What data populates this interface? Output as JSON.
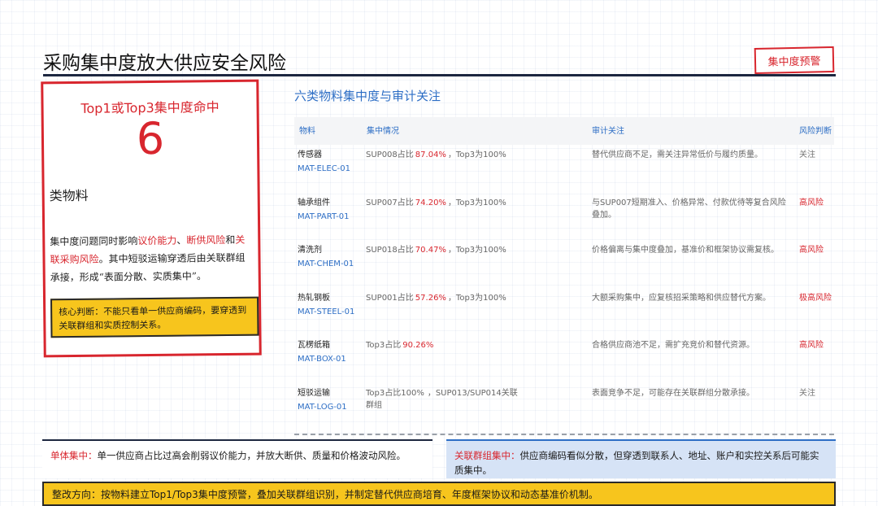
{
  "header": {
    "title": "采购集中度放大供应安全风险",
    "badge": "集中度预警"
  },
  "left_card": {
    "hit_title": "Top1或Top3集中度命中",
    "count": "6",
    "unit": "类物料",
    "desc_1": "集中度问题同时影响",
    "desc_red_1": "议价能力",
    "desc_sep": "、",
    "desc_red_2": "断供风险",
    "desc_and": "和",
    "desc_red_3": "关联采购风险",
    "desc_2": "。其中短驳运输穿透后由关联群组承接，形成“表面分散、实质集中”。",
    "core_judgement": "核心判断：不能只看单一供应商编码，要穿透到关联群组和实质控制关系。"
  },
  "section": {
    "title": "六类物料集中度与审计关注"
  },
  "table": {
    "headers": {
      "material": "物料",
      "concentration": "集中情况",
      "audit": "审计关注",
      "risk": "风险判断"
    },
    "rows": [
      {
        "name": "传感器",
        "code": "MAT-ELEC-01",
        "conc_prefix": "SUP008占比",
        "pct": "87.04%",
        "conc_suffix": "，Top3为100%",
        "audit": "替代供应商不足，需关注异常低价与履约质量。",
        "risk": "关注",
        "risk_color": "#777777"
      },
      {
        "name": "轴承组件",
        "code": "MAT-PART-01",
        "conc_prefix": "SUP007占比",
        "pct": "74.20%",
        "conc_suffix": "，Top3为100%",
        "audit": "与SUP007短期准入、价格异常、付款优待等复合风险叠加。",
        "risk": "高风险",
        "risk_color": "#d8262e"
      },
      {
        "name": "清洗剂",
        "code": "MAT-CHEM-01",
        "conc_prefix": "SUP018占比",
        "pct": "70.47%",
        "conc_suffix": "，Top3为100%",
        "audit": "价格偏离与集中度叠加，基准价和框架协议需复核。",
        "risk": "高风险",
        "risk_color": "#d8262e"
      },
      {
        "name": "热轧钢板",
        "code": "MAT-STEEL-01",
        "conc_prefix": "SUP001占比",
        "pct": "57.26%",
        "conc_suffix": "，Top3为100%",
        "audit": "大额采购集中，应复核招采策略和供应替代方案。",
        "risk": "极高风险",
        "risk_color": "#d8262e"
      },
      {
        "name": "瓦楞纸箱",
        "code": "MAT-BOX-01",
        "conc_prefix": "Top3占比",
        "pct": "90.26%",
        "conc_suffix": "",
        "audit": "合格供应商池不足，需扩充竞价和替代资源。",
        "risk": "高风险",
        "risk_color": "#d8262e"
      },
      {
        "name": "短驳运输",
        "code": "MAT-LOG-01",
        "conc_prefix": "Top3占比100%",
        "pct": "",
        "conc_suffix": "，SUP013/SUP014关联群组",
        "audit": "表面竞争不足，可能存在关联群组分散承接。",
        "risk": "关注",
        "risk_color": "#777777"
      }
    ]
  },
  "bottom": {
    "single_tag": "单体集中：",
    "single_text": "单一供应商占比过高会削弱议价能力，并放大断供、质量和价格波动风险。",
    "linked_tag": "关联群组集中：",
    "linked_text": "供应商编码看似分散，但穿透到联系人、地址、账户和实控关系后可能实质集中。",
    "direction": "整改方向：按物料建立Top1/Top3集中度预警，叠加关联群组识别，并制定替代供应商培育、年度框架协议和动态基准价机制。"
  },
  "colors": {
    "accent_red": "#d8262e",
    "accent_blue": "#2d6ec5",
    "highlight_yellow": "#f7c51d",
    "rule_navy": "#1d2740"
  }
}
